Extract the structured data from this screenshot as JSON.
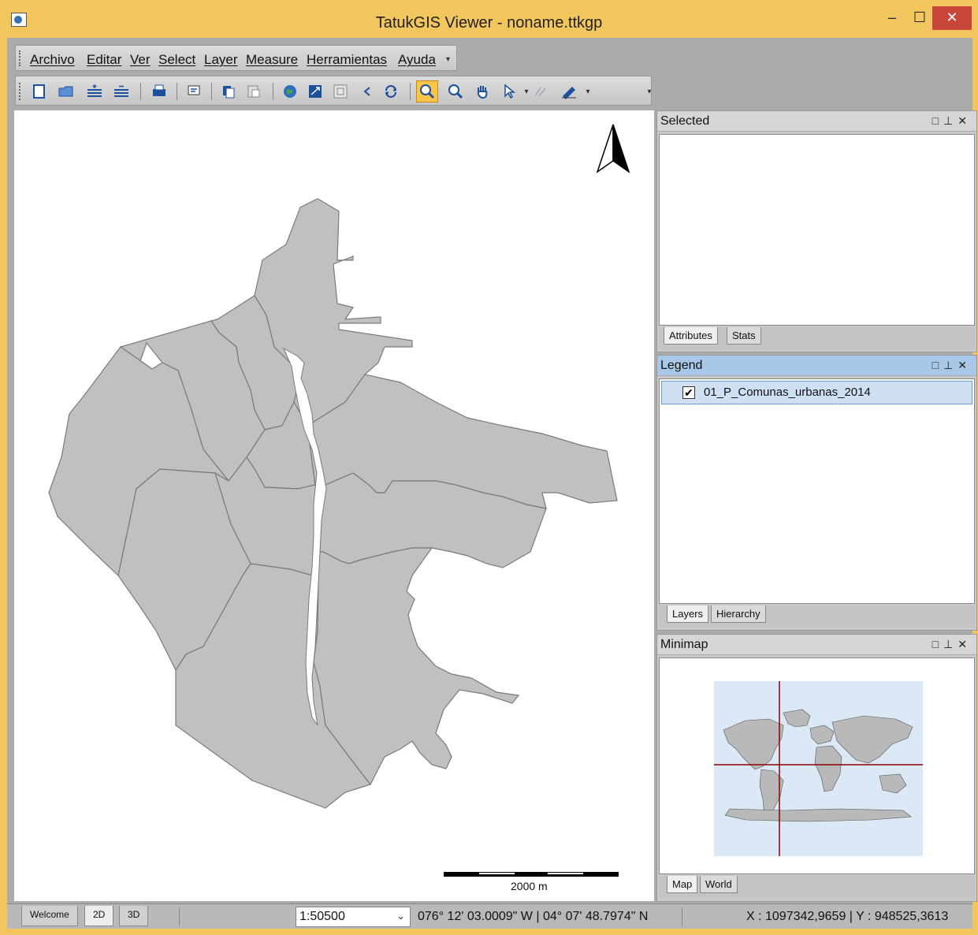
{
  "window": {
    "title": "TatukGIS Viewer - noname.ttkgp",
    "minimize": "–",
    "maximize": "☐",
    "close": "✕"
  },
  "menubar": {
    "items": [
      "Archivo",
      "Editar",
      "Ver",
      "Select",
      "Layer",
      "Measure",
      "Herramientas",
      "Ayuda"
    ]
  },
  "toolbar": {
    "icons": [
      "new-file-icon",
      "open-folder-icon",
      "add-layer-icon",
      "remove-layer-icon",
      "print-icon",
      "export-icon",
      "copy-icon",
      "paste-icon",
      "globe-icon",
      "full-extent-icon",
      "zoom-layer-icon",
      "back-icon",
      "refresh-icon",
      "zoom-icon",
      "magnifier-icon",
      "pan-hand-icon",
      "select-arrow-icon",
      "edit-icon",
      "measure-ruler-icon"
    ],
    "active_tool": "zoom-icon"
  },
  "map": {
    "scale_label": "2000 m",
    "fill_color": "#c0c0c0",
    "stroke_color": "#7a7a7a"
  },
  "panels": {
    "selected": {
      "title": "Selected",
      "tabs": [
        "Attributes",
        "Stats"
      ],
      "active_tab": "Attributes"
    },
    "legend": {
      "title": "Legend",
      "layer": "01_P_Comunas_urbanas_2014",
      "checked": true,
      "tabs": [
        "Layers",
        "Hierarchy"
      ],
      "active_tab": "Layers"
    },
    "minimap": {
      "title": "Minimap",
      "tabs": [
        "Map",
        "World"
      ],
      "active_tab": "Map",
      "crosshair_color": "#8b0000"
    }
  },
  "statusbar": {
    "tabs": [
      "Welcome",
      "2D",
      "3D"
    ],
    "active_tab": "2D",
    "scale": "1:50500",
    "geo_coords": "076° 12' 03.0009\" W | 04° 07' 48.7974\" N",
    "xy_coords": "X : 1097342,9659 | Y : 948525,3613"
  }
}
